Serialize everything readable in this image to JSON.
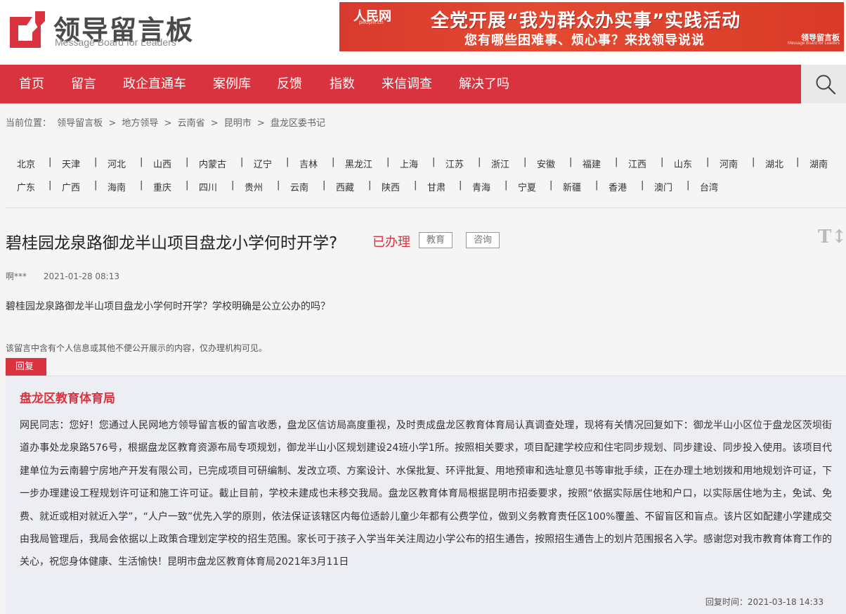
{
  "site": {
    "title": "领导留言板",
    "subtitle": "Message Board for Leaders"
  },
  "banner": {
    "source_logo": "人民网",
    "source_logo_sub": "people.cn",
    "headline": "全党开展“我为群众办实事”实践活动",
    "subline": "您有哪些困难事、烦心事？来找领导说说",
    "brand": "领导留言板",
    "brand_sub": "Message Board for Leaders"
  },
  "nav": {
    "items": [
      "首页",
      "留言",
      "政企直通车",
      "案例库",
      "反馈",
      "指数",
      "来信调查",
      "解决了吗"
    ],
    "search_icon": "search-icon"
  },
  "breadcrumb": {
    "prefix": "当前位置：",
    "items": [
      "领导留言板",
      "地方领导",
      "云南省",
      "昆明市",
      "盘龙区委书记"
    ],
    "separator": ">"
  },
  "provinces": {
    "row1": [
      "北京",
      "天津",
      "河北",
      "山西",
      "内蒙古",
      "辽宁",
      "吉林",
      "黑龙江",
      "上海",
      "江苏",
      "浙江",
      "安徽",
      "福建",
      "江西",
      "山东",
      "河南",
      "湖北",
      "湖南"
    ],
    "row2": [
      "广东",
      "广西",
      "海南",
      "重庆",
      "四川",
      "贵州",
      "云南",
      "西藏",
      "陕西",
      "甘肃",
      "青海",
      "宁夏",
      "新疆",
      "香港",
      "澳门",
      "台湾"
    ],
    "separator": "|"
  },
  "question": {
    "title": "碧桂园龙泉路御龙半山项目盘龙小学何时开学?",
    "status": "已办理",
    "tags": [
      "教育",
      "咨询"
    ],
    "font_tool": "T↕",
    "author": "啊***",
    "date": "2021-01-28 08:13",
    "body": "碧桂园龙泉路御龙半山项目盘龙小学何时开学？学校明确是公立公办的吗？",
    "privacy_note": "该留言中含有个人信息或其他不便公开展示的内容，仅办理机构可见。"
  },
  "reply": {
    "tab_label": "回复",
    "org": "盘龙区教育体育局",
    "text": "网民同志：您好！您通过人民网地方领导留言板的留言收悉，盘龙区信访局高度重视，及时责成盘龙区教育体育局认真调查处理，现将有关情况回复如下：御龙半山小区位于盘龙区茨坝街道办事处龙泉路576号，根据盘龙区教育资源布局专项规划，御龙半山小区规划建设24班小学1所。按照相关要求，项目配建学校应和住宅同步规划、同步建设、同步投入使用。该项目代建单位为云南碧宁房地产开发有限公司，已完成项目可研编制、发改立项、方案设计、水保批复、环评批复、用地预审和选址意见书等审批手续，正在办理土地划拨和用地规划许可证，下一步办理建设工程规划许可证和施工许可证。截止目前，学校未建成也未移交我局。盘龙区教育体育局根据昆明市招委要求，按照“依据实际居住地和户口，以实际居住地为主，免试、免费、就近或相对就近入学”，“人户一致”优先入学的原则，依法保证该辖区内每位适龄儿童少年都有公费学位，做到义务教育责任区100%覆盖、不留盲区和盲点。该片区如配建小学建成交由我局管理后，我局会依据以上政策合理划定学校的招生范围。家长可于孩子入学当年关注周边小学公布的招生通告，按照招生通告上的划片范围报名入学。感谢您对我市教育体育工作的关心，祝您身体健康、生活愉快！昆明市盘龙区教育体育局2021年3月11日",
    "time_label": "回复时间：",
    "time": "2021-03-18 14:33"
  },
  "colors": {
    "accent": "#d8333f",
    "reply_bg": "#eceef3",
    "banner_bg": "#e04a32"
  }
}
